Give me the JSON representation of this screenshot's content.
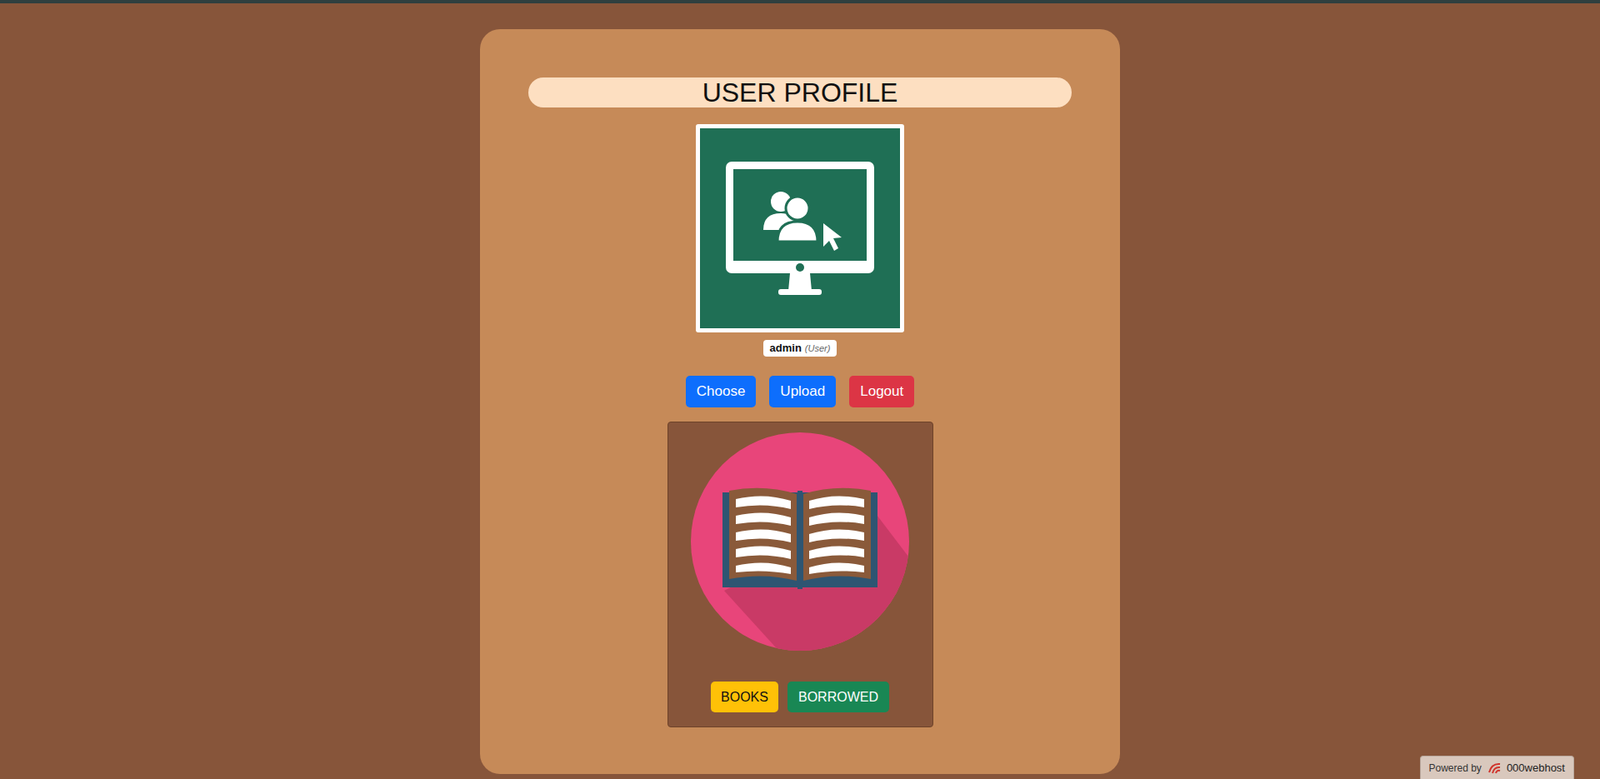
{
  "header": {
    "title": "USER PROFILE"
  },
  "user": {
    "name": "admin",
    "role": "(User)"
  },
  "profile_buttons": [
    {
      "label": "Choose",
      "kind": "primary"
    },
    {
      "label": "Upload",
      "kind": "primary"
    },
    {
      "label": "Logout",
      "kind": "danger"
    }
  ],
  "library_buttons": [
    {
      "label": "BOOKS",
      "kind": "warning"
    },
    {
      "label": "BORROWED",
      "kind": "success"
    }
  ],
  "footer": {
    "prefix": "Powered by",
    "brand": "000webhost"
  }
}
